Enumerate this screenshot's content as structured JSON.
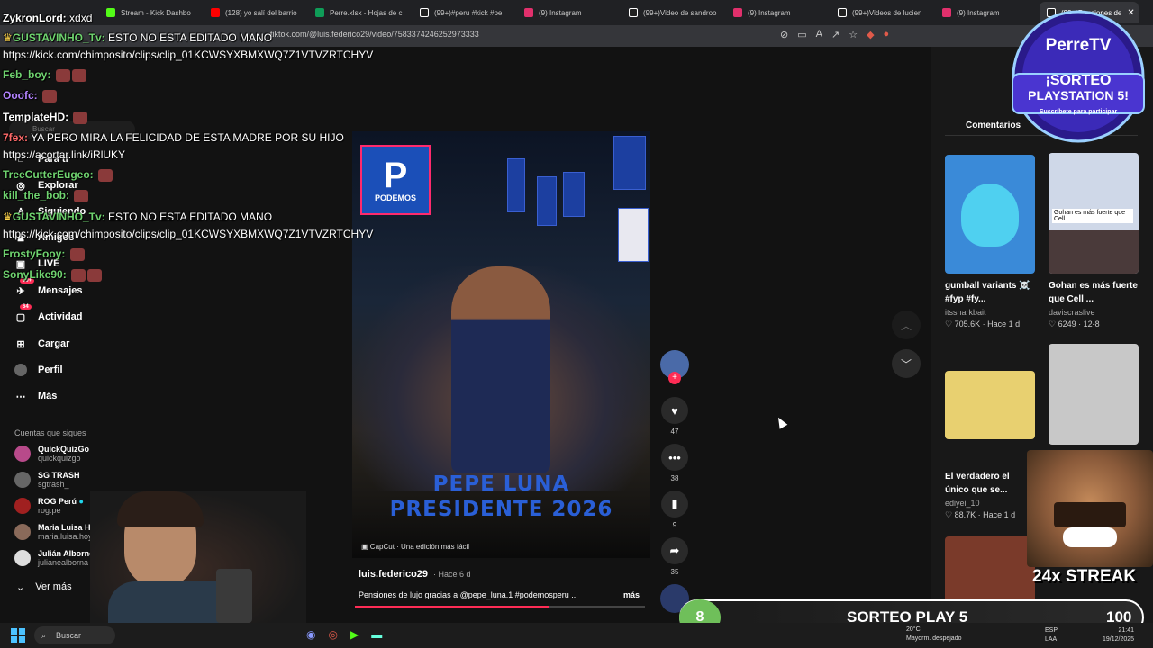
{
  "browser": {
    "tabs": [
      {
        "label": "Stream - Kick Dashbo",
        "color": "#53fc18"
      },
      {
        "label": "(128) yo salí del barrio",
        "color": "#ff0000"
      },
      {
        "label": "Perre.xlsx - Hojas de c",
        "color": "#0f9d58"
      },
      {
        "label": "(99+)#peru #kick #pe",
        "color": "#ffffff"
      },
      {
        "label": "(9) Instagram",
        "color": "#e1306c"
      },
      {
        "label": "(99+)Video de sandroo",
        "color": "#ffffff"
      },
      {
        "label": "(9) Instagram",
        "color": "#e1306c"
      },
      {
        "label": "(99+)Videos de lucien",
        "color": "#ffffff"
      },
      {
        "label": "(9) Instagram",
        "color": "#e1306c"
      },
      {
        "label": "(99+)Pensiones de",
        "color": "#ffffff"
      }
    ],
    "url": "tiktok.com/@luis.federico29/video/7583374246252973333"
  },
  "sidebar": {
    "search_placeholder": "Buscar",
    "items": [
      {
        "label": "Para ti",
        "icon": "home-icon"
      },
      {
        "label": "Explorar",
        "icon": "compass-icon"
      },
      {
        "label": "Siguiendo",
        "icon": "users-icon"
      },
      {
        "label": "Amigos",
        "icon": "friends-icon"
      },
      {
        "label": "LIVE",
        "icon": "live-icon"
      },
      {
        "label": "Mensajes",
        "icon": "message-icon",
        "badge": "99+"
      },
      {
        "label": "Actividad",
        "icon": "activity-icon",
        "badge": "64"
      },
      {
        "label": "Cargar",
        "icon": "upload-icon"
      },
      {
        "label": "Perfil",
        "icon": "profile-icon"
      },
      {
        "label": "Más",
        "icon": "more-icon"
      }
    ],
    "following_title": "Cuentas que sigues",
    "following": [
      {
        "name": "QuickQuizGo",
        "handle": "quickquizgo"
      },
      {
        "name": "SG TRASH",
        "handle": "sgtrash_"
      },
      {
        "name": "ROG Perú",
        "handle": "rog.pe"
      },
      {
        "name": "Maria Luisa Hoyos",
        "handle": "maria.luisa.hoyos"
      },
      {
        "name": "Julián Albornoz",
        "handle": "julianealborna"
      }
    ],
    "see_more": "Ver más"
  },
  "video": {
    "logo_letter": "P",
    "logo_name": "PODEMOS",
    "headline_1": "PEPE LUNA",
    "headline_2": "PRESIDENTE 2026",
    "capcut": "CapCut · Una edición más fácil",
    "author": "luis.federico29",
    "ago": "· Hace 6 d",
    "caption": "Pensiones de lujo gracias a @pepe_luna.1 #podemosperu ...",
    "more": "más",
    "progress": 0.67
  },
  "actions": {
    "likes": "47",
    "comments": "38",
    "saves": "9",
    "shares": "35"
  },
  "right_panel": {
    "tab": "Comentarios",
    "videos": [
      {
        "title": "gumball variants ☠️ #fyp #fy...",
        "user": "itssharkbait",
        "views": "705.6K",
        "ago": "Hace 1 d"
      },
      {
        "title": "Gohan es más fuerte que Cell ...",
        "user": "daviscraslive",
        "views": "6249",
        "ago": "12-8"
      },
      {
        "title": "El verdadero el único que se...",
        "user": "ediyei_10",
        "views": "88.7K",
        "ago": "Hace 1 d"
      }
    ],
    "thumb_caption": "Gohan es más fuerte que Cell"
  },
  "chat": [
    {
      "user": "ZykronLord:",
      "text": "xdxd",
      "color": "#ffffff"
    },
    {
      "user": "GUSTAVINHO_Tv:",
      "text": "ESTO NO ESTA EDITADO MANO",
      "color": "#6fd36f"
    },
    {
      "user": "Feb_boy:",
      "text": "",
      "color": "#6fd36f"
    },
    {
      "user": "Ooofc:",
      "text": "",
      "color": "#b383ff"
    },
    {
      "user": "TemplateHD:",
      "text": "",
      "color": "#ffffff"
    },
    {
      "user": "7fex:",
      "text": "YA PERO MIRA LA FELICIDAD DE ESTA MADRE POR SU HIJO",
      "color": "#ff6a6a"
    },
    {
      "user": "TreeCutterEugeo:",
      "text": "",
      "color": "#6fd36f"
    },
    {
      "user": "kill_the_bob:",
      "text": "",
      "color": "#6fd36f"
    },
    {
      "user": "GUSTAVINHO_Tv:",
      "text": "ESTO NO ESTA EDITADO MANO",
      "color": "#6fd36f"
    },
    {
      "user": "FrostyFooy:",
      "text": "",
      "color": "#6fd36f"
    },
    {
      "user": "SonyLike90:",
      "text": "",
      "color": "#6fd36f"
    }
  ],
  "chat_links": [
    "https://kick.com/chimposito/clips/clip_01KCWSYXBMXWQ7Z1VTVZRTCHYV",
    "https://acortar.link/iRlUKY",
    "https://kick.com/chimposito/clips/clip_01KCWSYXBMXWQ7Z1VTVZRTCHYV"
  ],
  "overlay": {
    "brand": "PerreTV",
    "promo_1": "¡SORTEO",
    "promo_2": "PLAYSTATION 5!",
    "promo_3": "Suscríbete para participar",
    "streak": "24x STREAK",
    "raffle_count": "8",
    "raffle_title": "SORTEO PLAY 5",
    "raffle_total": "100"
  },
  "taskbar": {
    "search": "Buscar",
    "weather": "20°C",
    "weather_sub": "Mayorm. despejado",
    "lang": "ESP",
    "lang_sub": "LAA",
    "time": "21:41",
    "date": "19/12/2025"
  }
}
